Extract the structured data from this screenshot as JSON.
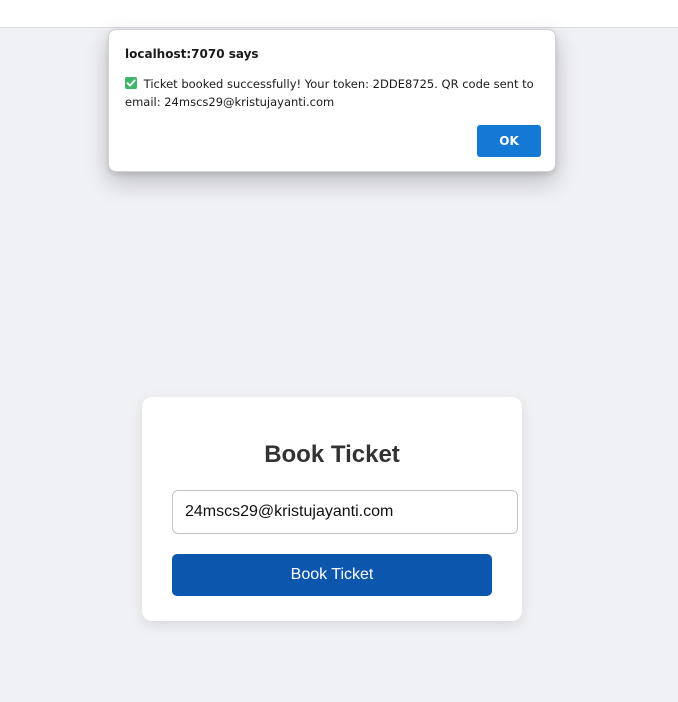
{
  "dialog": {
    "title": "localhost:7070 says",
    "message": "Ticket booked successfully! Your token: 2DDE8725. QR code sent to email: 24mscs29@kristujayanti.com",
    "ok_label": "OK",
    "icon": "check-mark-icon",
    "icon_color": "#3fb46b",
    "button_color": "#1479d5"
  },
  "card": {
    "title": "Book Ticket",
    "email_value": "24mscs29@kristujayanti.com",
    "button_label": "Book Ticket",
    "button_color": "#0d56ad"
  },
  "page": {
    "background": "#f0f1f5"
  }
}
